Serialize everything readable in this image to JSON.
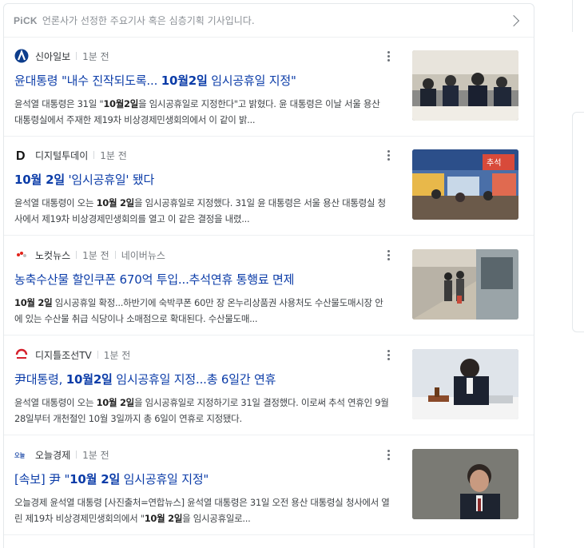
{
  "pick": {
    "logo": "PiCK",
    "description": "언론사가 선정한 주요기사 혹은 심층기획 기사입니다."
  },
  "articles": [
    {
      "press": "신아일보",
      "time": "1분 전",
      "extra": "",
      "title_parts": [
        {
          "text": "윤대통령 \"내수 진작되도록... ",
          "bold": false
        },
        {
          "text": "10월2일",
          "bold": true
        },
        {
          "text": " 임시공휴일 지정\"",
          "bold": false
        }
      ],
      "snippet_parts": [
        {
          "text": "윤석열 대통령은 31일 \"",
          "bold": false
        },
        {
          "text": "10월2일",
          "bold": true
        },
        {
          "text": "을 임시공휴일로 지정한다\"고 밝혔다. 윤 대통령은 이날 서울 용산 대통령실에서 주재한 제19차 비상경제민생회의에서 이 같이 밝...",
          "bold": false
        }
      ],
      "logo_icon": "sinailbo-logo-icon",
      "thumb": "meeting-photo"
    },
    {
      "press": "디지털투데이",
      "time": "1분 전",
      "extra": "",
      "title_parts": [
        {
          "text": "10월 2일",
          "bold": true
        },
        {
          "text": " '임시공휴일' 됐다",
          "bold": false
        }
      ],
      "snippet_parts": [
        {
          "text": "윤석열 대통령이 오는 ",
          "bold": false
        },
        {
          "text": "10월 2일",
          "bold": true
        },
        {
          "text": "을 임시공휴일로 지정했다. 31일 윤 대통령은 서울 용산 대통령실 청사에서 제19차 비상경제민생회의를 열고 이 같은 결정을 내렸...",
          "bold": false
        }
      ],
      "logo_icon": "digitaltoday-logo-icon",
      "thumb": "market-photo"
    },
    {
      "press": "노컷뉴스",
      "time": "1분 전",
      "extra": "네이버뉴스",
      "title_parts": [
        {
          "text": "농축수산물 할인쿠폰 670억 투입...추석연휴 통행료 면제",
          "bold": false
        }
      ],
      "snippet_parts": [
        {
          "text": "10월 2일",
          "bold": true
        },
        {
          "text": " 임시공휴일 확정...하반기에 숙박쿠폰 60만 장 온누리상품권 사용처도 수산물도매시장 안에 있는 수산물 취급 식당이나 소매점으로 확대된다. 수산물도매...",
          "bold": false
        }
      ],
      "logo_icon": "nocutnews-logo-icon",
      "thumb": "train-station-photo"
    },
    {
      "press": "디지틀조선TV",
      "time": "1분 전",
      "extra": "",
      "title_parts": [
        {
          "text": "尹대통령, ",
          "bold": false
        },
        {
          "text": "10월2일",
          "bold": true
        },
        {
          "text": " 임시공휴일 지정...총 6일간 연휴",
          "bold": false
        }
      ],
      "snippet_parts": [
        {
          "text": "윤석열 대통령이 오는 ",
          "bold": false
        },
        {
          "text": "10월 2일",
          "bold": true
        },
        {
          "text": "을 임시공휴일로 지정하기로 31일 결정했다. 이로써 추석 연휴인 9월 28일부터 개천절인 10월 3일까지 총 6일이 연휴로 지정됐다.",
          "bold": false
        }
      ],
      "logo_icon": "dizzotv-logo-icon",
      "thumb": "gavel-photo"
    },
    {
      "press": "오늘경제",
      "time": "1분 전",
      "extra": "",
      "title_parts": [
        {
          "text": "[속보] 尹 \"",
          "bold": false
        },
        {
          "text": "10월 2일",
          "bold": true
        },
        {
          "text": " 임시공휴일 지정\"",
          "bold": false
        }
      ],
      "snippet_parts": [
        {
          "text": "오늘경제 윤석열 대통령 [사진출처=연합뉴스] 윤석열 대통령은 31일 오전 용산 대통령실 청사에서 열린 제19차 비상경제민생회의에서 \"",
          "bold": false
        },
        {
          "text": "10월 2일",
          "bold": true
        },
        {
          "text": "을 임시공휴일로...",
          "bold": false
        }
      ],
      "logo_icon": "oneuleconomy-logo-icon",
      "logo_text": "오늘",
      "thumb": "portrait-photo"
    }
  ],
  "colors": {
    "title": "#0b3ca8",
    "meta": "#767b80",
    "border": "#e4e8eb"
  }
}
